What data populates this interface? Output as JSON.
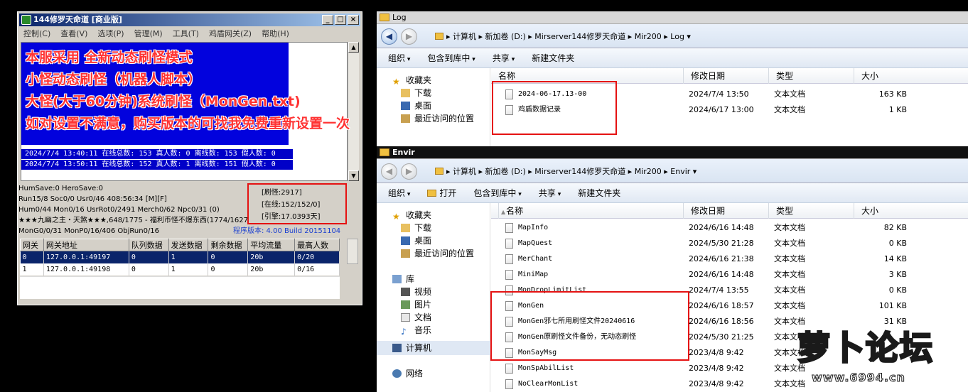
{
  "server": {
    "title": "144修罗天命道 [商业版]",
    "menu": [
      "控制(C)",
      "查看(V)",
      "选项(P)",
      "管理(M)",
      "工具(T)",
      "鸡盾网关(Z)",
      "帮助(H)"
    ],
    "log_lines": [
      "2024/7/4 13:40:11 在线总数: 153 真人数: 0 离线数: 153 假人数: 0",
      "2024/7/4 13:50:11 在线总数: 152 真人数: 1 离线数: 151 假人数: 0"
    ],
    "overlay": [
      "本服采用 全新动态刷怪模式",
      "小怪动态刷怪（机器人脚本）",
      "大怪(大于60分钟)系统刷怪（MonGen.txt)",
      "如对设置不满意，购买版本的可找我免费重新设置一次"
    ],
    "stats": [
      "HumSave:0 HeroSave:0",
      "Run15/8 Soc0/0 Usr0/46          408:56:34 [M][F]",
      "Hum0/44 Mon0/16 UsrRot0/2491 Merch0/62 Npc0/31 (0)",
      "★★★九幽之主・天煞★★★,648/1775 - 福利币怪不爆东西(1774/1627)",
      "MonG0/0/31 MonP0/16/406 ObjRun0/16"
    ],
    "version": "程序版本: 4.00 Build 20151104",
    "info": [
      "[刷怪:2917]",
      "[在线:152/152/0]",
      "[引擎:17.0393天]"
    ],
    "gate_headers": [
      "网关",
      "网关地址",
      "队列数据",
      "发送数据",
      "剩余数据",
      "平均流量",
      "最高人数"
    ],
    "gate_rows": [
      [
        "0",
        "127.0.0.1:49197",
        "0",
        "1",
        "0",
        "20b",
        "0/20"
      ],
      [
        "1",
        "127.0.0.1:49198",
        "0",
        "1",
        "0",
        "20b",
        "0/16"
      ]
    ]
  },
  "log_window": {
    "title": "Log",
    "breadcrumb": "▸ 计算机 ▸ 新加卷 (D:) ▸ Mirserver144修罗天命道 ▸ Mir200 ▸ Log ▾",
    "toolbar": [
      "组织",
      "包含到库中",
      "共享",
      "新建文件夹"
    ],
    "nav": [
      "收藏夹",
      "下载",
      "桌面",
      "最近访问的位置"
    ],
    "headers": [
      "名称",
      "修改日期",
      "类型",
      "大小"
    ],
    "files": [
      {
        "name": "2024-06-17.13-00",
        "date": "2024/7/4 13:50",
        "type": "文本文档",
        "size": "163 KB"
      },
      {
        "name": "鸡盾数据记录",
        "date": "2024/6/17 13:00",
        "type": "文本文档",
        "size": "1 KB"
      }
    ]
  },
  "envir_window": {
    "title": "Envir",
    "breadcrumb": "▸ 计算机 ▸ 新加卷 (D:) ▸ Mirserver144修罗天命道 ▸ Mir200 ▸ Envir ▾",
    "toolbar": [
      "组织",
      "打开",
      "包含到库中",
      "共享",
      "新建文件夹"
    ],
    "nav": [
      "收藏夹",
      "下载",
      "桌面",
      "最近访问的位置",
      "库",
      "视频",
      "图片",
      "文档",
      "音乐",
      "计算机",
      "网络"
    ],
    "headers": [
      "名称",
      "修改日期",
      "类型",
      "大小"
    ],
    "files": [
      {
        "name": "MapInfo",
        "date": "2024/6/16 14:48",
        "type": "文本文档",
        "size": "82 KB"
      },
      {
        "name": "MapQuest",
        "date": "2024/5/30 21:28",
        "type": "文本文档",
        "size": "0 KB"
      },
      {
        "name": "MerChant",
        "date": "2024/6/16 21:38",
        "type": "文本文档",
        "size": "14 KB"
      },
      {
        "name": "MiniMap",
        "date": "2024/6/16 14:48",
        "type": "文本文档",
        "size": "3 KB"
      },
      {
        "name": "MonDropLimitList",
        "date": "2024/7/4 13:55",
        "type": "文本文档",
        "size": "0 KB"
      },
      {
        "name": "MonGen",
        "date": "2024/6/16 18:57",
        "type": "文本文档",
        "size": "101 KB"
      },
      {
        "name": "MonGen邪七所用刷怪文件20240616",
        "date": "2024/6/16 18:56",
        "type": "文本文档",
        "size": "31 KB"
      },
      {
        "name": "MonGen原刷怪文件备份，无动态刷怪",
        "date": "2024/5/30 21:25",
        "type": "文本文档",
        "size": ""
      },
      {
        "name": "MonSayMsg",
        "date": "2023/4/8 9:42",
        "type": "文本文档",
        "size": ""
      },
      {
        "name": "MonSpAbilList",
        "date": "2023/4/8 9:42",
        "type": "文本文档",
        "size": ""
      },
      {
        "name": "NoClearMonList",
        "date": "2023/4/8 9:42",
        "type": "文本文档",
        "size": ""
      }
    ]
  },
  "watermark": {
    "part1": "萝",
    "part2": "卜",
    "part3": "论坛",
    "url": "www.6994.cn"
  }
}
